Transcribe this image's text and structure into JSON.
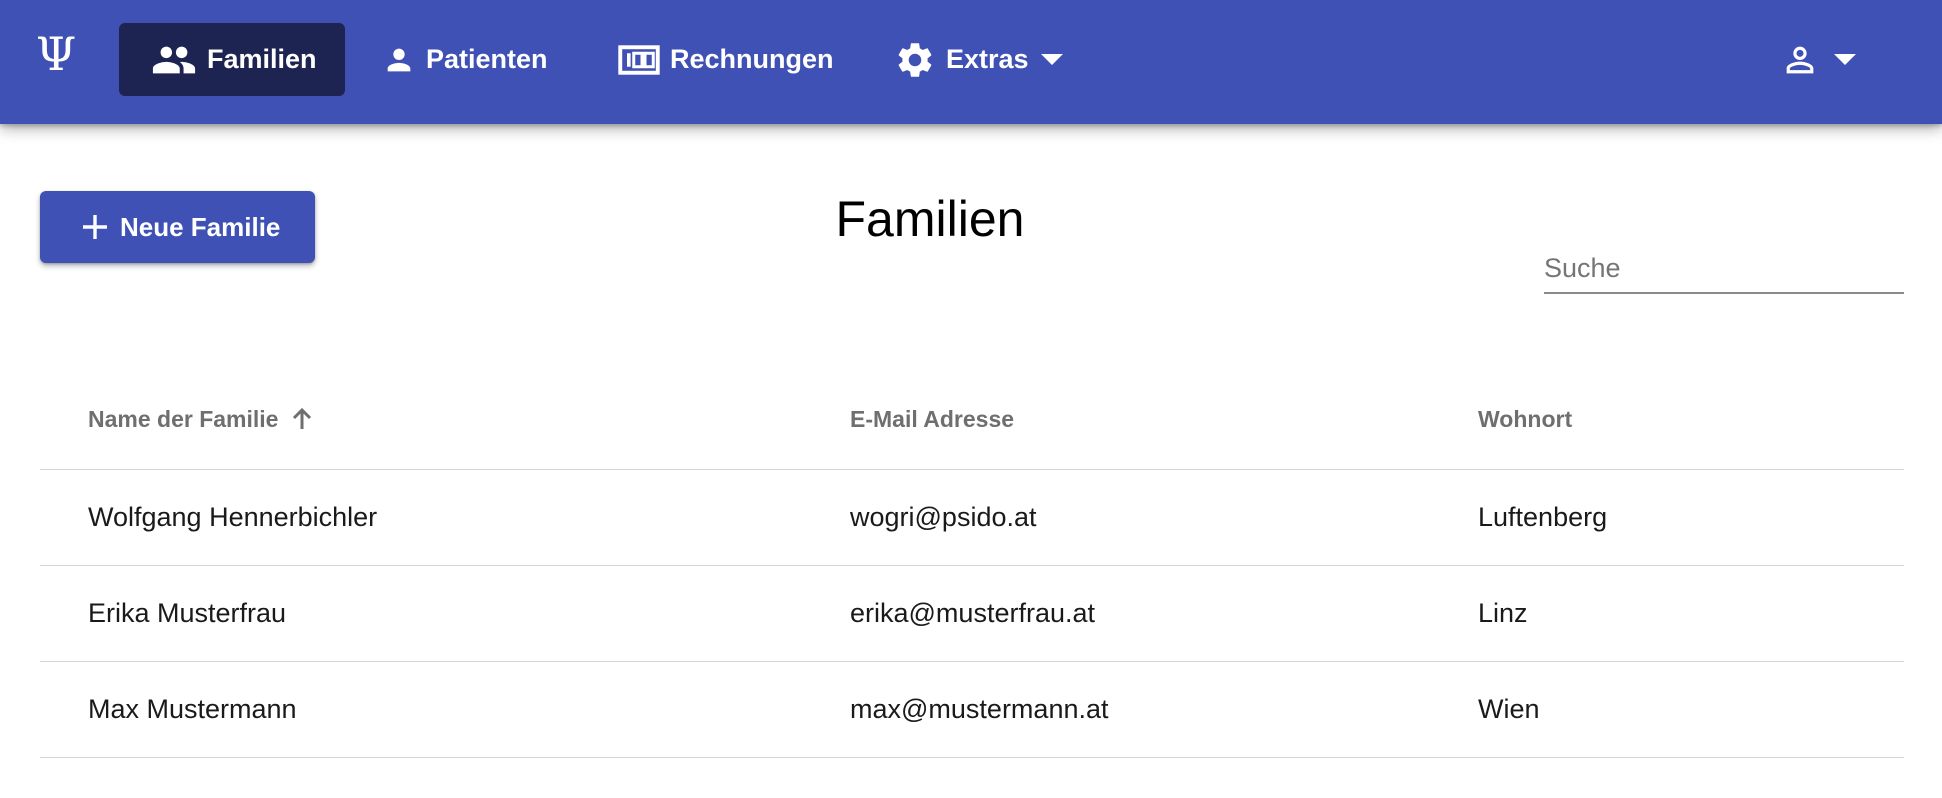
{
  "header": {
    "logo_symbol": "Ψ",
    "nav": [
      {
        "label": "Familien",
        "icon": "people-icon",
        "active": true
      },
      {
        "label": "Patienten",
        "icon": "person-icon",
        "active": false
      },
      {
        "label": "Rechnungen",
        "icon": "money-icon",
        "active": false
      },
      {
        "label": "Extras",
        "icon": "gear-icon",
        "active": false,
        "has_dropdown": true
      }
    ],
    "user_menu": {
      "icon": "account-outline-icon",
      "has_dropdown": true
    }
  },
  "toolbar": {
    "new_button_label": "Neue Familie",
    "page_title": "Familien",
    "search_placeholder": "Suche",
    "search_value": ""
  },
  "table": {
    "columns": [
      "Name der Familie",
      "E-Mail Adresse",
      "Wohnort"
    ],
    "sort": {
      "column": "Name der Familie",
      "direction": "ascending"
    },
    "rows": [
      [
        "Wolfgang Hennerbichler",
        "wogri@psido.at",
        "Luftenberg"
      ],
      [
        "Erika Musterfrau",
        "erika@musterfrau.at",
        "Linz"
      ],
      [
        "Max Mustermann",
        "max@mustermann.at",
        "Wien"
      ]
    ]
  },
  "colors": {
    "primary": "#3f51b5",
    "active_nav": "#1e2452",
    "header_text": "#ffffff"
  }
}
